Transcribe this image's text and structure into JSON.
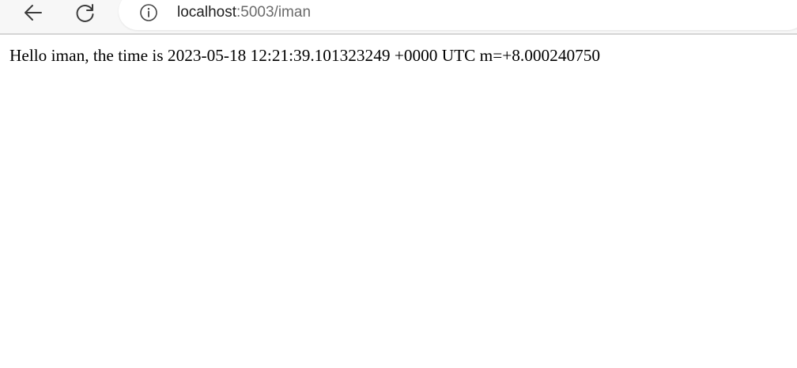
{
  "browser": {
    "url_host": "localhost",
    "url_path": ":5003/iman",
    "icons": {
      "back": "arrow-left-icon",
      "reload": "reload-icon",
      "site_info": "info-circle-icon"
    }
  },
  "page": {
    "message": "Hello iman, the time is 2023-05-18 12:21:39.101323249 +0000 UTC m=+8.000240750"
  }
}
